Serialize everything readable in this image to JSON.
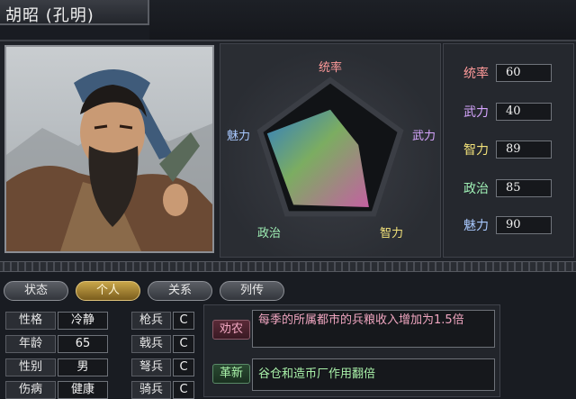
{
  "officer": {
    "name": "胡昭 (孔明)"
  },
  "radar": {
    "labels": {
      "top": "统率",
      "right": "武力",
      "bottom_right": "智力",
      "bottom_left": "政治",
      "left": "魅力"
    },
    "values": {
      "tongshuai": 60,
      "wuli": 40,
      "zhili": 89,
      "zhengzhi": 85,
      "meili": 90
    },
    "max": 100
  },
  "stats": [
    {
      "label": "统率",
      "value": "60",
      "color": "#ff9a9a"
    },
    {
      "label": "武力",
      "value": "40",
      "color": "#d7a6ff"
    },
    {
      "label": "智力",
      "value": "89",
      "color": "#f3e27a"
    },
    {
      "label": "政治",
      "value": "85",
      "color": "#9ff0b5"
    },
    {
      "label": "魅力",
      "value": "90",
      "color": "#a9c9ff"
    }
  ],
  "tabs": [
    {
      "label": "状态",
      "active": false
    },
    {
      "label": "个人",
      "active": true
    },
    {
      "label": "关系",
      "active": false
    },
    {
      "label": "列传",
      "active": false
    }
  ],
  "personal": [
    {
      "label": "性格",
      "value": "冷静"
    },
    {
      "label": "年龄",
      "value": "65"
    },
    {
      "label": "性别",
      "value": "男"
    },
    {
      "label": "伤病",
      "value": "健康"
    }
  ],
  "aptitude": [
    {
      "label": "枪兵",
      "value": "C"
    },
    {
      "label": "戟兵",
      "value": "C"
    },
    {
      "label": "弩兵",
      "value": "C"
    },
    {
      "label": "骑兵",
      "value": "C"
    }
  ],
  "skills": [
    {
      "name": "劝农",
      "desc": "每季的所属都市的兵粮收入增加为1.5倍",
      "color": "#f0a6c0"
    },
    {
      "name": "革新",
      "desc": "谷仓和造币厂作用翻倍",
      "color": "#a8f0a8"
    }
  ],
  "colors": {
    "accent_tab": "#c9a64a",
    "panel": "#1f2228"
  }
}
